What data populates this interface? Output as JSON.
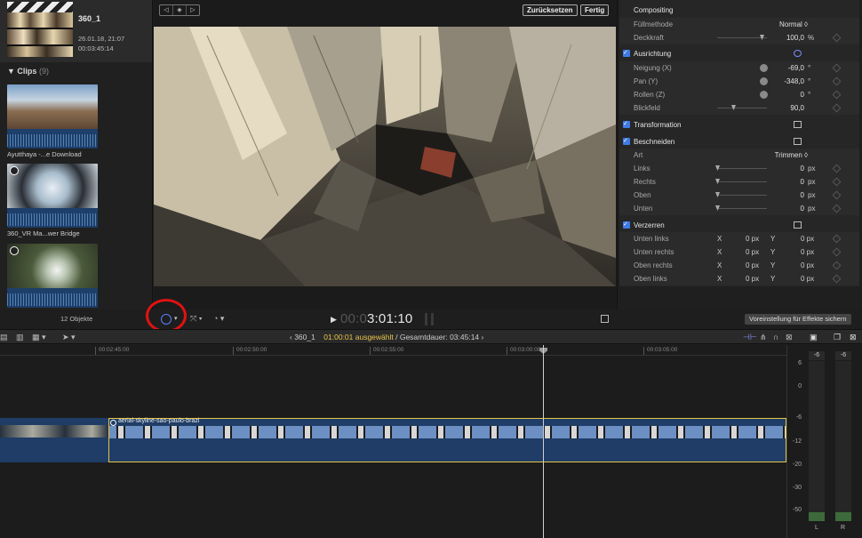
{
  "browser": {
    "event": {
      "title": "360_1",
      "date": "26.01.18, 21:07",
      "duration": "00:03:45:14"
    },
    "clips_header": "Clips",
    "clips_count": "(9)",
    "clips": [
      {
        "label": "Ayutthaya -...e Download"
      },
      {
        "label": "360_VR Ma...wer Bridge"
      },
      {
        "label": ""
      }
    ],
    "object_count": "12 Objekte"
  },
  "viewer": {
    "reset_button": "Zurücksetzen",
    "done_button": "Fertig",
    "timecode_dim": "00:0",
    "timecode": "3:01:10"
  },
  "inspector": {
    "compositing": "Compositing",
    "blend_label": "Füllmethode",
    "blend_value": "Normal ◊",
    "opacity_label": "Deckkraft",
    "opacity_value": "100,0",
    "opacity_unit": "%",
    "orientation": "Ausrichtung",
    "tilt_label": "Neigung (X)",
    "tilt_value": "-69,0",
    "pan_label": "Pan (Y)",
    "pan_value": "-348,0",
    "roll_label": "Rollen (Z)",
    "roll_value": "0",
    "fov_label": "Blickfeld",
    "fov_value": "90,0",
    "degree": "°",
    "transform": "Transformation",
    "crop": "Beschneiden",
    "crop_type_label": "Art",
    "crop_type_value": "Trimmen ◊",
    "left_label": "Links",
    "right_label": "Rechts",
    "top_label": "Oben",
    "bottom_label": "Unten",
    "zero": "0",
    "px": "px",
    "distort": "Verzerren",
    "bl_label": "Unten links",
    "br_label": "Unten rechts",
    "tr_label": "Oben rechts",
    "tl_label": "Oben links",
    "x": "X",
    "y": "Y",
    "zero_px": "0 px",
    "save_preset": "Voreinstellung für Effekte sichern"
  },
  "timeline": {
    "project": "360_1",
    "selected": "01:00:01 ausgewählt",
    "total": "/ Gesamtdauer: 03:45:14",
    "ruler": [
      "00:02:45:00",
      "00:02:50:00",
      "00:02:55:00",
      "00:03:00:00",
      "00:03:05:00"
    ],
    "clip_name": "aerial-skyline-sao-paulo-brazi"
  },
  "meters": {
    "peak_l": "-6",
    "peak_r": "-6",
    "scale": [
      "6",
      "0",
      "-6",
      "-12",
      "-20",
      "-30",
      "-50"
    ],
    "left": "L",
    "right": "R"
  }
}
